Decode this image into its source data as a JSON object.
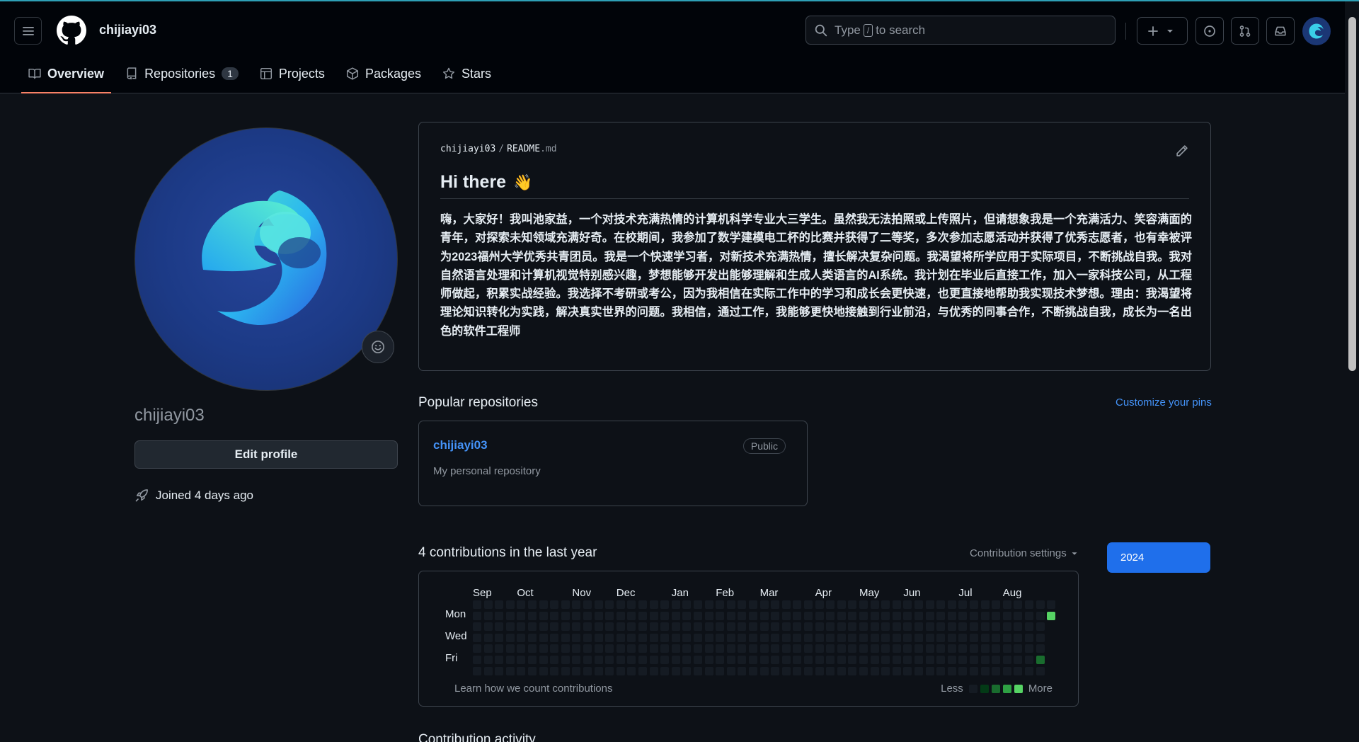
{
  "header": {
    "username": "chijiayi03",
    "search_placeholder_pre": "Type",
    "search_placeholder_key": "/",
    "search_placeholder_post": "to search"
  },
  "nav": {
    "overview": "Overview",
    "repositories": "Repositories",
    "repositories_count": "1",
    "projects": "Projects",
    "packages": "Packages",
    "stars": "Stars"
  },
  "profile": {
    "login": "chijiayi03",
    "edit_label": "Edit profile",
    "joined": "Joined 4 days ago"
  },
  "readme": {
    "owner": "chijiayi03",
    "sep": "/",
    "file": "README",
    "ext": ".md",
    "heading": "Hi there",
    "heading_emoji": "👋",
    "body": "嗨，大家好！我叫池家益，一个对技术充满热情的计算机科学专业大三学生。虽然我无法拍照或上传照片，但请想象我是一个充满活力、笑容满面的青年，对探索未知领域充满好奇。在校期间，我参加了数学建模电工杯的比赛并获得了二等奖，多次参加志愿活动并获得了优秀志愿者，也有幸被评为2023福州大学优秀共青团员。我是一个快速学习者，对新技术充满热情，擅长解决复杂问题。我渴望将所学应用于实际项目，不断挑战自我。我对自然语言处理和计算机视觉特别感兴趣，梦想能够开发出能够理解和生成人类语言的AI系统。我计划在毕业后直接工作，加入一家科技公司，从工程师做起，积累实战经验。我选择不考研或考公，因为我相信在实际工作中的学习和成长会更快速，也更直接地帮助我实现技术梦想。理由：我渴望将理论知识转化为实践，解决真实世界的问题。我相信，通过工作，我能够更快地接触到行业前沿，与优秀的同事合作，不断挑战自我，成长为一名出色的软件工程师"
  },
  "popular": {
    "title": "Popular repositories",
    "customize": "Customize your pins",
    "repos": [
      {
        "name": "chijiayi03",
        "visibility": "Public",
        "description": "My personal repository"
      }
    ]
  },
  "contributions": {
    "title": "4 contributions in the last year",
    "settings": "Contribution settings",
    "year": "2024",
    "months": [
      "Sep",
      "Oct",
      "Nov",
      "Dec",
      "Jan",
      "Feb",
      "Mar",
      "Apr",
      "May",
      "Jun",
      "Jul",
      "Aug"
    ],
    "days": [
      "Mon",
      "Wed",
      "Fri"
    ],
    "learn": "Learn how we count contributions",
    "less": "Less",
    "more": "More",
    "levels": [
      "#151b23",
      "#033a16",
      "#196c2e",
      "#2ea043",
      "#56d364"
    ],
    "active_cells": [
      {
        "week": 52,
        "day": 1,
        "level": 4
      },
      {
        "week": 51,
        "day": 5,
        "level": 2
      }
    ]
  },
  "activity": {
    "title": "Contribution activity"
  }
}
